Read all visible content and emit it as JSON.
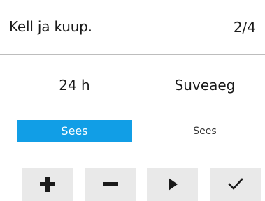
{
  "header": {
    "title": "Kell ja kuup.",
    "page_indicator": "2/4"
  },
  "left_column": {
    "label": "24 h",
    "option": "Sees"
  },
  "right_column": {
    "label": "Suveaeg",
    "option": "Sees"
  },
  "colors": {
    "selected": "#119ee6",
    "button_bg": "#e9e9e9"
  },
  "buttons": [
    {
      "icon": "plus-icon"
    },
    {
      "icon": "minus-icon"
    },
    {
      "icon": "play-icon"
    },
    {
      "icon": "checkmark-icon"
    }
  ]
}
